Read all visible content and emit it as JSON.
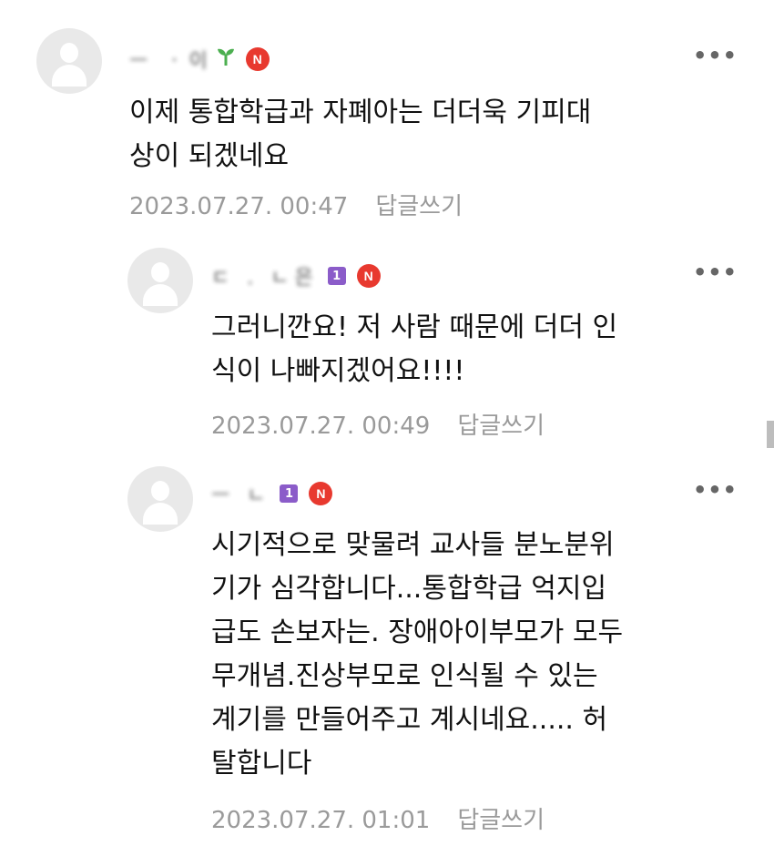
{
  "comments": [
    {
      "author": "ㅡ ㆍ이",
      "text_lines": [
        "이제 통합학급과 자폐아는 더더욱 기피대",
        "상이 되겠네요"
      ],
      "date": "2023.07.27. 00:47",
      "reply_label": "답글쓰기",
      "n_badge": "N",
      "more": "•••"
    },
    {
      "author": "ㄷ   . ㄴ은",
      "level_badge": "1",
      "text_lines": [
        "그러니깐요! 저 사람 때문에 더더 인",
        "식이 나빠지겠어요!!!!"
      ],
      "date": "2023.07.27. 00:49",
      "reply_label": "답글쓰기",
      "n_badge": "N",
      "more": "•••"
    },
    {
      "author": "ㅡ     ㄴ",
      "level_badge": "1",
      "text_lines": [
        "시기적으로 맞물려 교사들 분노분위",
        "기가 심각합니다...통합학급 억지입",
        "급도 손보자는. 장애아이부모가 모두",
        "무개념.진상부모로 인식될 수 있는",
        "계기를 만들어주고 계시네요..... 허",
        "탈합니다"
      ],
      "date": "2023.07.27. 01:01",
      "reply_label": "답글쓰기",
      "n_badge": "N",
      "more": "•••"
    }
  ],
  "colors": {
    "n_badge": "#e8392f",
    "level_badge": "#8b5cc9",
    "meta_text": "#9a9a9a",
    "avatar_bg": "#e9e9e9"
  }
}
